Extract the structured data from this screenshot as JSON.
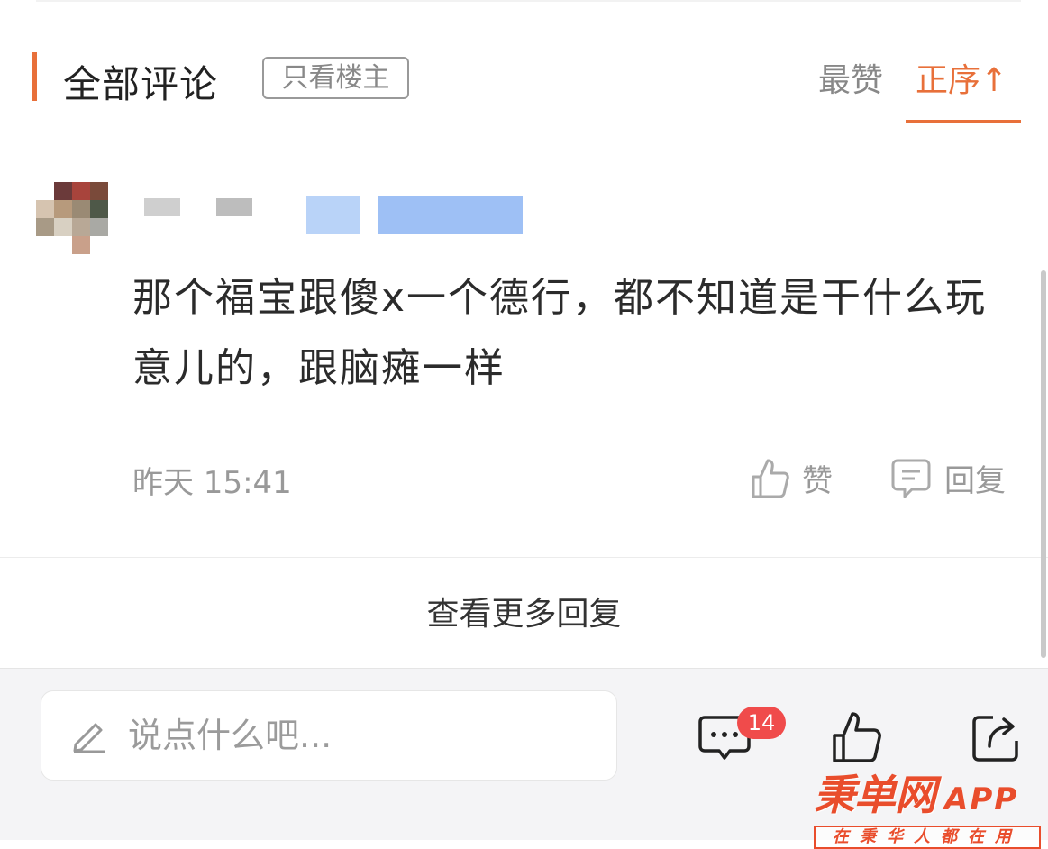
{
  "header": {
    "title": "全部评论",
    "filter_label": "只看楼主",
    "sort_hot": "最赞",
    "sort_asc": "正序↑"
  },
  "comment": {
    "text": "那个福宝跟傻x一个德行，都不知道是干什么玩意儿的，跟脑瘫一样",
    "time": "昨天 15:41",
    "like_label": "赞",
    "reply_label": "回复"
  },
  "more_replies": "查看更多回复",
  "bottom_bar": {
    "input_placeholder": "说点什么吧...",
    "comment_count": "14"
  },
  "watermark": {
    "name": "秉单网",
    "app": "APP",
    "slogan": "在秉华人都在用"
  },
  "colors": {
    "accent": "#e8703a",
    "badge": "#f04b4b",
    "muted": "#999999"
  }
}
